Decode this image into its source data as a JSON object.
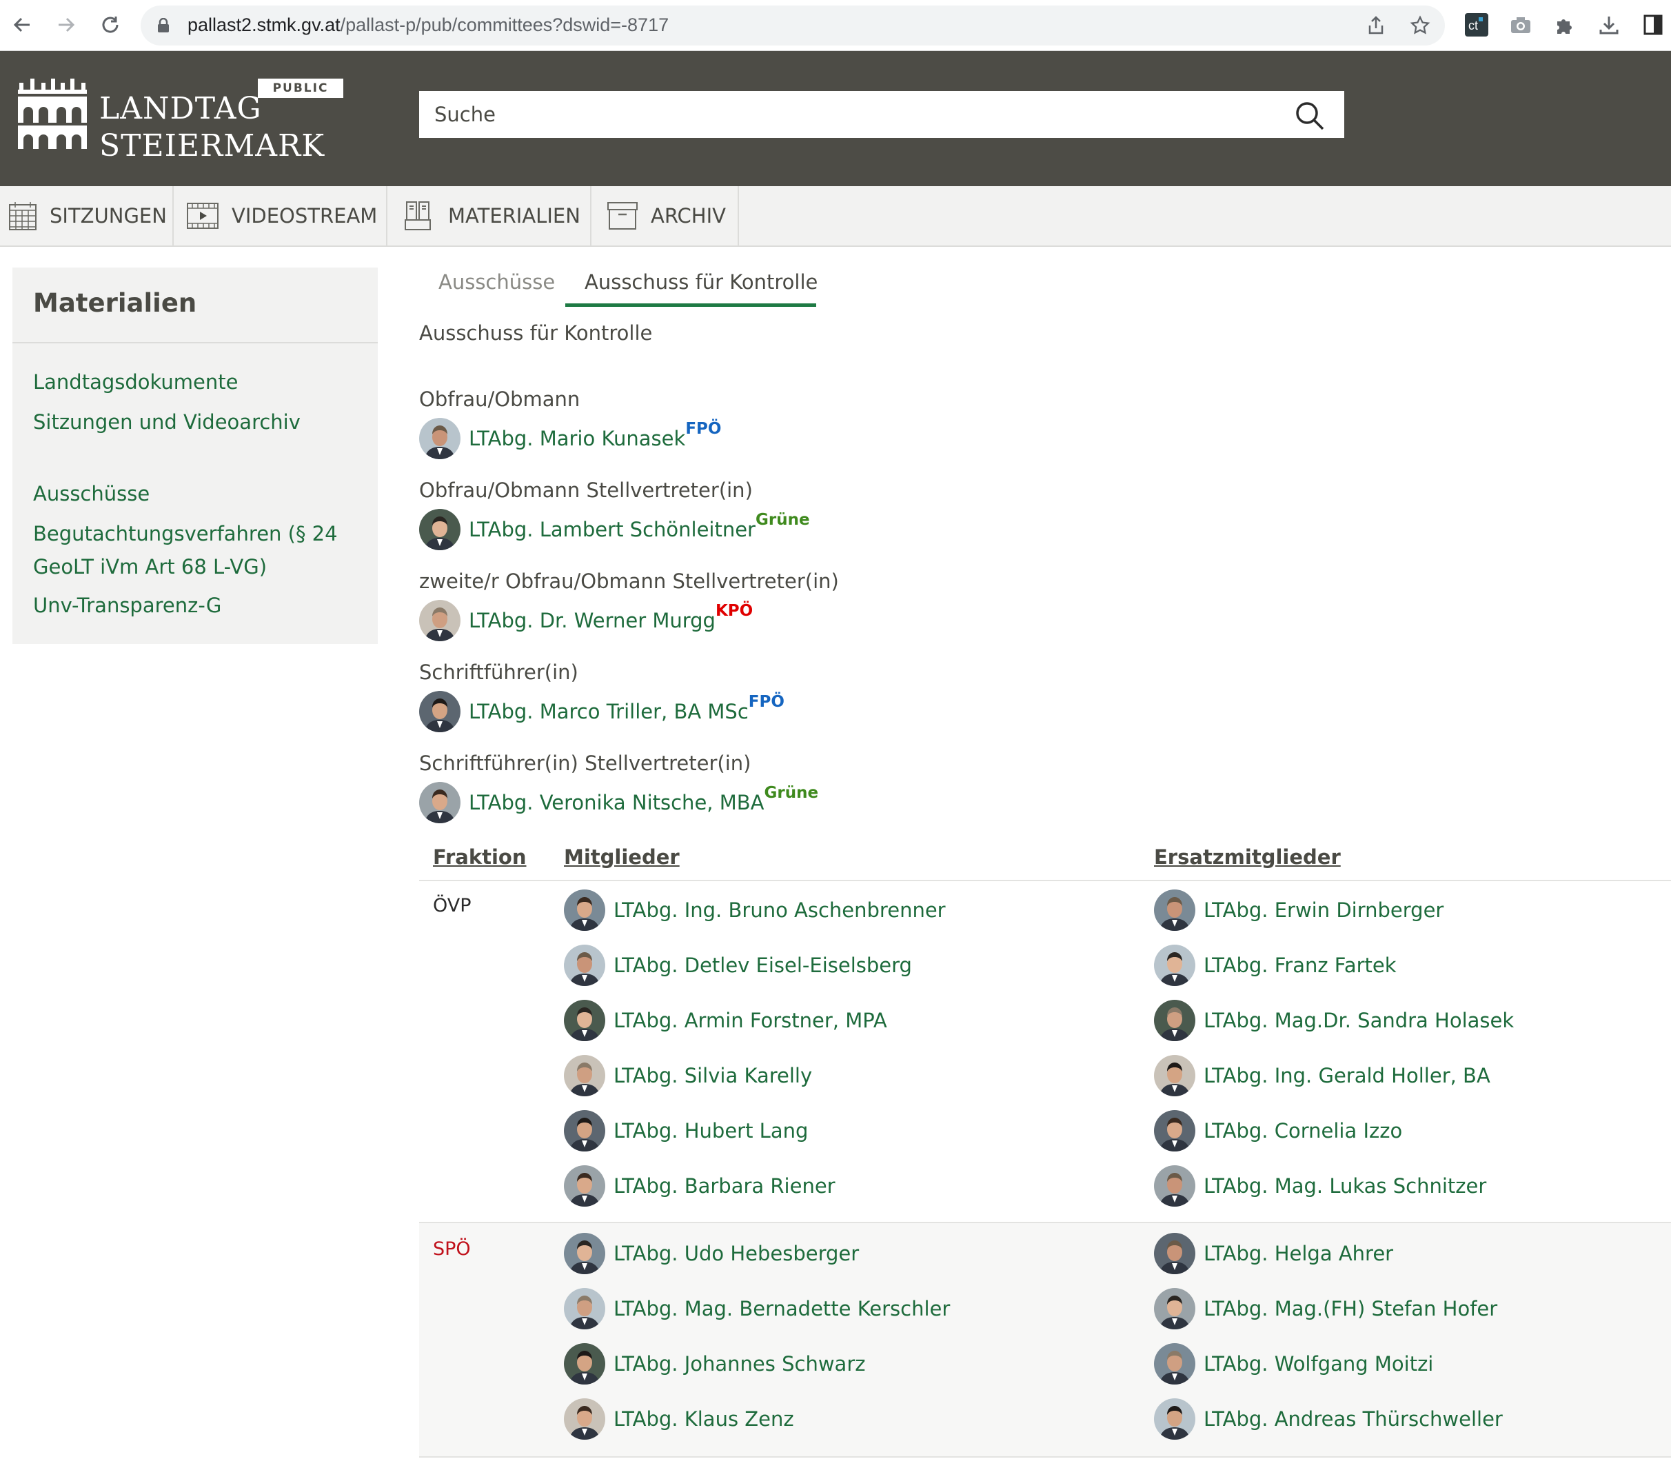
{
  "browser": {
    "url_host": "pallast2.stmk.gv.at",
    "url_path": "/pallast-p/pub/committees?dswid=-8717"
  },
  "header": {
    "logo_line1": "LANDTAG",
    "logo_line2": "STEIERMARK",
    "badge": "PUBLIC",
    "search_placeholder": "Suche"
  },
  "nav": {
    "items": [
      {
        "label": "SITZUNGEN",
        "icon": "calendar-icon"
      },
      {
        "label": "VIDEOSTREAM",
        "icon": "video-icon"
      },
      {
        "label": "MATERIALIEN",
        "icon": "documents-icon"
      },
      {
        "label": "ARCHIV",
        "icon": "archive-icon"
      }
    ]
  },
  "sidebar": {
    "title": "Materialien",
    "links": [
      "Landtagsdokumente",
      "Sitzungen und Videoarchiv",
      "Ausschüsse",
      "Begutachtungsverfahren (§ 24 GeoLT iVm Art 68 L-VG)",
      "Unv-Transparenz-G"
    ]
  },
  "tabs": {
    "inactive": "Ausschüsse",
    "active": "Ausschuss für Kontrolle"
  },
  "heading": "Ausschuss für Kontrolle",
  "roles": [
    {
      "label": "Obfrau/Obmann",
      "name": "LTAbg. Mario Kunasek",
      "party": "FPÖ",
      "party_color": "#1565c0"
    },
    {
      "label": "Obfrau/Obmann Stellvertreter(in)",
      "name": "LTAbg. Lambert Schönleitner",
      "party": "Grüne",
      "party_color": "#3f8a1e"
    },
    {
      "label": "zweite/r Obfrau/Obmann Stellvertreter(in)",
      "name": "LTAbg. Dr. Werner Murgg",
      "party": "KPÖ",
      "party_color": "#e00000"
    },
    {
      "label": "Schriftführer(in)",
      "name": "LTAbg. Marco Triller, BA MSc",
      "party": "FPÖ",
      "party_color": "#1565c0"
    },
    {
      "label": "Schriftführer(in) Stellvertreter(in)",
      "name": "LTAbg. Veronika Nitsche, MBA",
      "party": "Grüne",
      "party_color": "#3f8a1e"
    }
  ],
  "table": {
    "headers": [
      "Fraktion",
      "Mitglieder",
      "Ersatzmitglieder"
    ],
    "groups": [
      {
        "fraktion": "ÖVP",
        "fraktion_color": "#2b2b2b",
        "members": [
          "LTAbg. Ing. Bruno Aschenbrenner",
          "LTAbg. Detlev Eisel-Eiselsberg",
          "LTAbg. Armin Forstner, MPA",
          "LTAbg. Silvia Karelly",
          "LTAbg. Hubert Lang",
          "LTAbg. Barbara Riener"
        ],
        "substitutes": [
          "LTAbg. Erwin Dirnberger",
          "LTAbg. Franz Fartek",
          "LTAbg. Mag.Dr. Sandra Holasek",
          "LTAbg. Ing. Gerald Holler, BA",
          "LTAbg. Cornelia Izzo",
          "LTAbg. Mag. Lukas Schnitzer"
        ]
      },
      {
        "fraktion": "SPÖ",
        "fraktion_color": "#c0101a",
        "members": [
          "LTAbg. Udo Hebesberger",
          "LTAbg. Mag. Bernadette Kerschler",
          "LTAbg. Johannes Schwarz",
          "LTAbg. Klaus Zenz"
        ],
        "substitutes": [
          "LTAbg. Helga Ahrer",
          "LTAbg. Mag.(FH) Stefan Hofer",
          "LTAbg. Wolfgang Moitzi",
          "LTAbg. Andreas Thürschweller"
        ]
      }
    ]
  }
}
